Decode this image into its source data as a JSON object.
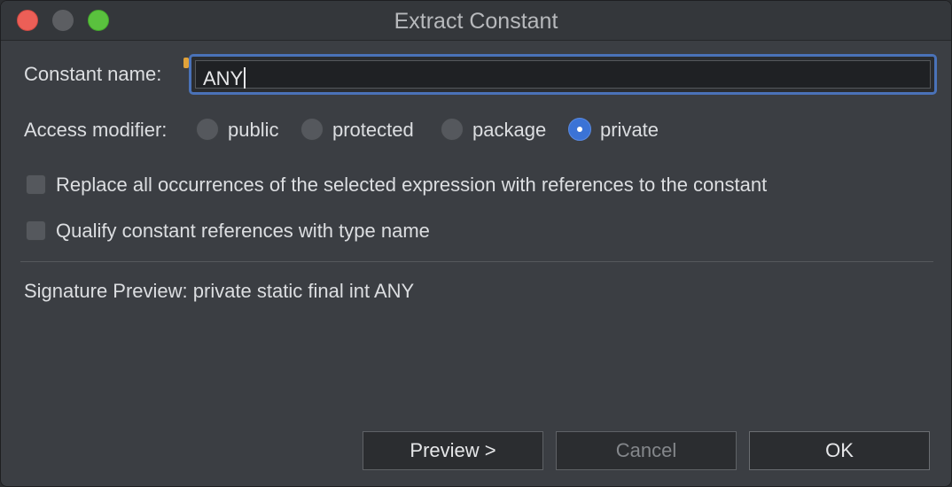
{
  "window": {
    "title": "Extract Constant"
  },
  "constant_name": {
    "label": "Constant name:",
    "value": "ANY"
  },
  "access_modifier": {
    "label": "Access modifier:",
    "options": [
      {
        "label": "public",
        "selected": false
      },
      {
        "label": "protected",
        "selected": false
      },
      {
        "label": "package",
        "selected": false
      },
      {
        "label": "private",
        "selected": true
      }
    ]
  },
  "options": {
    "replace_all": {
      "label": "Replace all occurrences of the selected expression with references to the constant",
      "checked": false
    },
    "qualify_refs": {
      "label": "Qualify constant references with type name",
      "checked": false
    }
  },
  "signature_preview": "Signature Preview: private static final int ANY",
  "buttons": {
    "preview": "Preview >",
    "cancel": "Cancel",
    "ok": "OK"
  },
  "colors": {
    "accent": "#4a72b8",
    "radio_selected": "#3b73d6",
    "background": "#3b3e43"
  }
}
